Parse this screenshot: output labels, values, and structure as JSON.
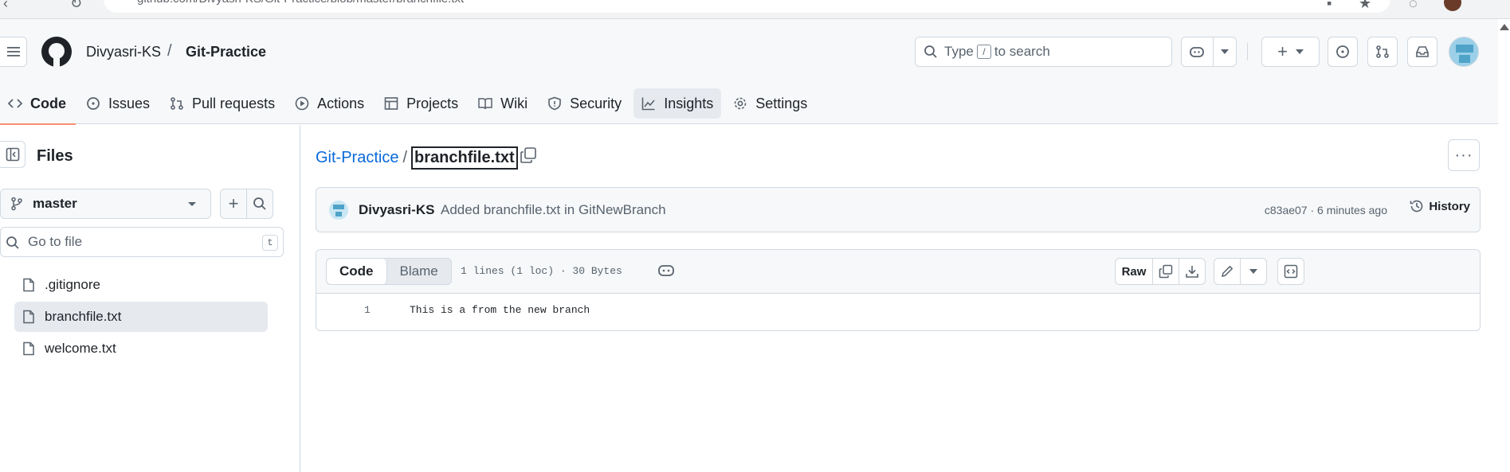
{
  "browser": {
    "url": "github.com/Divyasri-KS/Git-Practice/blob/master/branchfile.txt"
  },
  "header": {
    "owner": "Divyasri-KS",
    "separator": "/",
    "repo": "Git-Practice",
    "search_placeholder_pre": "Type",
    "search_key": "/",
    "search_placeholder_post": "to search"
  },
  "tabs": [
    {
      "label": "Code",
      "icon": "code-icon",
      "selected": true
    },
    {
      "label": "Issues",
      "icon": "issue-icon"
    },
    {
      "label": "Pull requests",
      "icon": "pull-request-icon"
    },
    {
      "label": "Actions",
      "icon": "play-icon"
    },
    {
      "label": "Projects",
      "icon": "table-icon"
    },
    {
      "label": "Wiki",
      "icon": "book-icon"
    },
    {
      "label": "Security",
      "icon": "shield-icon"
    },
    {
      "label": "Insights",
      "icon": "graph-icon",
      "hover": true
    },
    {
      "label": "Settings",
      "icon": "gear-icon"
    }
  ],
  "sidebar": {
    "title": "Files",
    "branch": "master",
    "goto_placeholder": "Go to file",
    "goto_key": "t",
    "files": [
      {
        "name": ".gitignore"
      },
      {
        "name": "branchfile.txt",
        "selected": true
      },
      {
        "name": "welcome.txt"
      }
    ]
  },
  "breadcrumb": {
    "repo": "Git-Practice",
    "separator": "/",
    "file": "branchfile.txt"
  },
  "commit": {
    "author": "Divyasri-KS",
    "message": "Added branchfile.txt in GitNewBranch",
    "meta": "c83ae07 · 6 minutes ago",
    "history_label": "History"
  },
  "code_view": {
    "tab_code": "Code",
    "tab_blame": "Blame",
    "info": "1 lines (1 loc) · 30 Bytes",
    "raw_label": "Raw",
    "lines": [
      {
        "number": "1",
        "text": "This is a from the new branch"
      }
    ]
  },
  "colors": {
    "accent": "#0969da",
    "selected_tab_underline": "#fd8c73",
    "border": "#d1d9e0",
    "header_bg": "#f6f8fa"
  }
}
